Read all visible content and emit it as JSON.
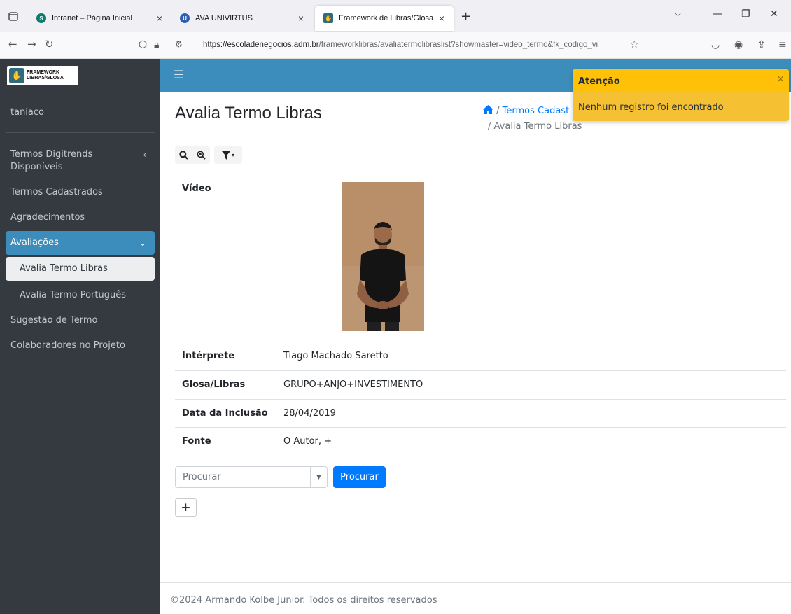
{
  "browser": {
    "tabs": [
      {
        "title": "Intranet – Página Inicial",
        "favicon_color": "#0f7b6c"
      },
      {
        "title": "AVA UNIVIRTUS",
        "favicon_color": "#2f5fb3"
      },
      {
        "title": "Framework de Libras/Glosa",
        "favicon_color": "#2f6b7d",
        "active": true
      }
    ],
    "url_host": "https://escoladenegocios.adm.br",
    "url_path": "/frameworklibras/avaliatermolibraslist?showmaster=video_termo&fk_codigo_vi"
  },
  "brand": {
    "line1": "FRAMEWORK",
    "line2": "LIBRAS/GLOSA"
  },
  "user": {
    "name": "taniaco"
  },
  "sidebar": {
    "items": [
      {
        "label": "Termos Digitrends Disponíveis"
      },
      {
        "label": "Termos Cadastrados"
      },
      {
        "label": "Agradecimentos"
      },
      {
        "label": "Avaliações"
      },
      {
        "label": "Avalia Termo Libras"
      },
      {
        "label": "Avalia Termo Português"
      },
      {
        "label": "Sugestão de Termo"
      },
      {
        "label": "Colaboradores no Projeto"
      }
    ]
  },
  "page": {
    "title": "Avalia Termo Libras",
    "breadcrumb": {
      "link": "Termos Cadast",
      "current": "Avalia Termo Libras",
      "sep": "/"
    }
  },
  "record": {
    "video_label": "Vídeo",
    "fields": [
      {
        "label": "Intérprete",
        "value": "Tiago Machado Saretto"
      },
      {
        "label": "Glosa/Libras",
        "value": "GRUPO+ANJO+INVESTIMENTO"
      },
      {
        "label": "Data da Inclusão",
        "value": "28/04/2019"
      },
      {
        "label": "Fonte",
        "value": "O Autor, +"
      }
    ]
  },
  "search": {
    "placeholder": "Procurar",
    "button": "Procurar"
  },
  "add_button": "+",
  "footer": {
    "text": "©2024 Armando Kolbe Junior. Todos os direitos reservados"
  },
  "toast": {
    "title": "Atenção",
    "message": "Nenhum registro foi encontrado",
    "close": "×"
  },
  "colors": {
    "sidebar": "#343a40",
    "header": "#3c8dbc",
    "primary": "#007bff",
    "warning": "#ffc107"
  },
  "icons": [
    "home-icon",
    "search-icon",
    "zoom-icon",
    "filter-icon",
    "hamburger-icon",
    "chevron-left-icon",
    "chevron-down-icon",
    "plus-icon",
    "close-icon"
  ]
}
